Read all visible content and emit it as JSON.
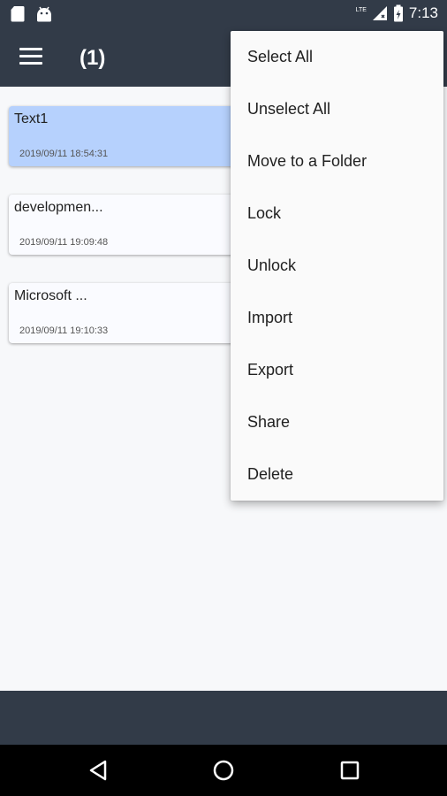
{
  "status_bar": {
    "network": "LTE",
    "time": "7:13"
  },
  "app_bar": {
    "title": "(1)"
  },
  "notes": [
    {
      "title": "Text1",
      "date": "2019/09/11 18:54:31",
      "selected": true
    },
    {
      "title": "developmen...",
      "date": "2019/09/11 19:09:48",
      "selected": false
    },
    {
      "title": "Microsoft ...",
      "date": "2019/09/11 19:10:33",
      "selected": false
    }
  ],
  "menu": {
    "items": [
      "Select All",
      "Unselect All",
      "Move to a Folder",
      "Lock",
      "Unlock",
      "Import",
      "Export",
      "Share",
      "Delete"
    ]
  },
  "colors": {
    "bar": "#323b48",
    "selected_card": "#b6d1fd",
    "background": "#f7f8fa"
  }
}
